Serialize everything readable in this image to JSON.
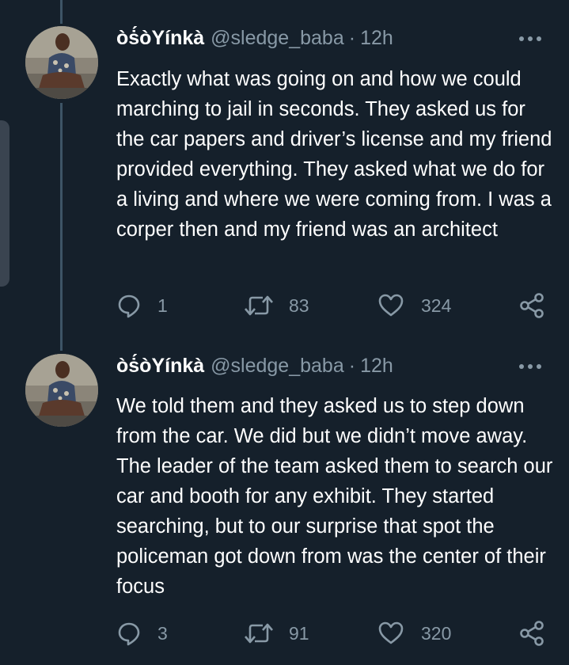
{
  "tweets": [
    {
      "display_name": "òṡ́òYínkà",
      "handle": "@sledge_baba",
      "separator": "·",
      "time": "12h",
      "text": "Exactly what was going on and how we could marching to jail in seconds. They asked us for the car papers and driver’s license and my friend provided everything. They asked what we do for a living and where we were coming from. I was a corper then and my friend was an architect",
      "replies": "1",
      "retweets": "83",
      "likes": "324"
    },
    {
      "display_name": "òṡ́òYínkà",
      "handle": "@sledge_baba",
      "separator": "·",
      "time": "12h",
      "text": "We told them and they asked us to step down from the car. We did but we didn’t move away. The leader of the team asked them to search our car and booth for any exhibit. They started searching, but to our surprise that spot the policeman got down from was the center of their focus",
      "replies": "3",
      "retweets": "91",
      "likes": "320"
    }
  ],
  "icons": {
    "reply": "reply-icon",
    "retweet": "retweet-icon",
    "like": "heart-icon",
    "share": "share-icon",
    "more": "more-icon"
  },
  "colors": {
    "background": "#15202b",
    "secondary_text": "#8899a6",
    "thread_line": "#3d5466"
  }
}
